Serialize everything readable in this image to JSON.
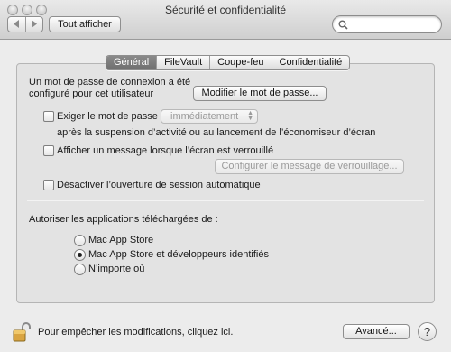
{
  "window": {
    "title": "Sécurité et confidentialité",
    "show_all_label": "Tout afficher",
    "search": {
      "value": "",
      "placeholder": ""
    }
  },
  "tabs": [
    {
      "label": "Général",
      "active": true
    },
    {
      "label": "FileVault",
      "active": false
    },
    {
      "label": "Coupe-feu",
      "active": false
    },
    {
      "label": "Confidentialité",
      "active": false
    }
  ],
  "general": {
    "password_text_line1": "Un mot de passe de connexion a été",
    "password_text_line2": "configuré pour cet utilisateur",
    "change_password_button": "Modifier le mot de passe...",
    "require_password": {
      "label": "Exiger le mot de passe",
      "checked": false,
      "select_value": "immédiatement",
      "after_text": "après la suspension d’activité ou au lancement de l’économiseur d’écran"
    },
    "show_message": {
      "label": "Afficher un message lorsque l’écran est verrouillé",
      "checked": false,
      "button": "Configurer le message de verrouillage..."
    },
    "disable_auto_login": {
      "label": "Désactiver l’ouverture de session automatique",
      "checked": false
    },
    "downloads_heading": "Autoriser les applications téléchargées de :",
    "download_options": [
      {
        "label": "Mac App Store",
        "selected": false
      },
      {
        "label": "Mac App Store et développeurs identifiés",
        "selected": true
      },
      {
        "label": "N’importe où",
        "selected": false
      }
    ]
  },
  "footer": {
    "lock_text": "Pour empêcher les modifications, cliquez ici.",
    "advanced_button": "Avancé...",
    "help_label": "?"
  },
  "icons": {
    "back": "chevron-left-icon",
    "forward": "chevron-right-icon",
    "search": "search-icon",
    "lock": "lock-open-icon",
    "help": "help-icon"
  }
}
